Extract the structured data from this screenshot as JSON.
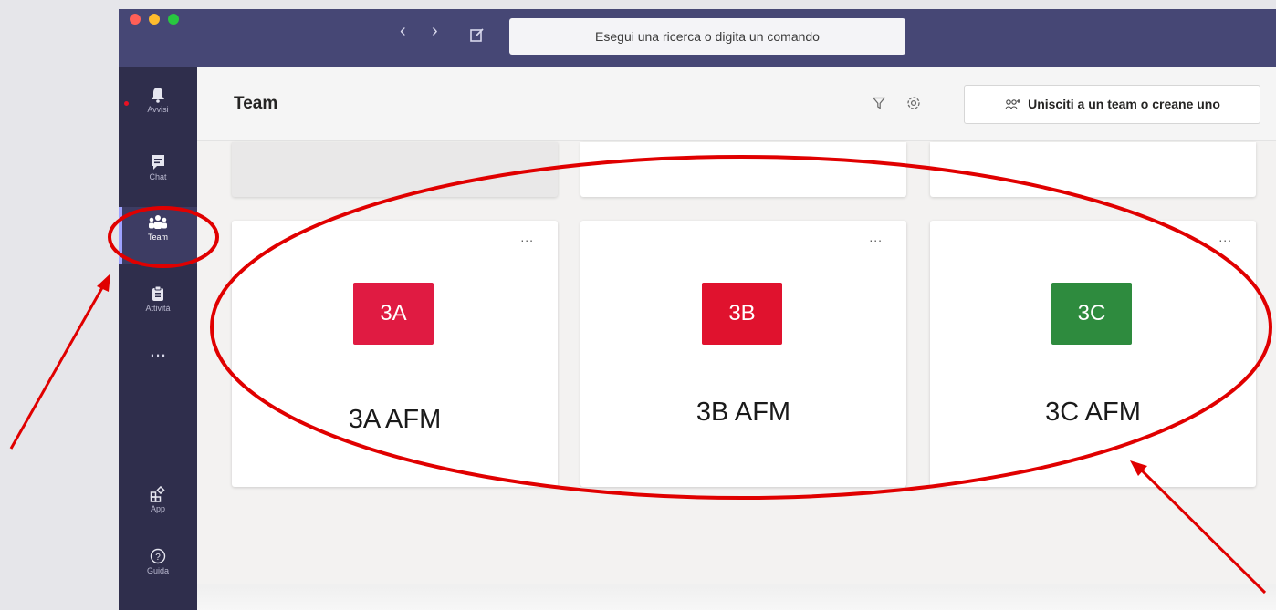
{
  "titlebar": {
    "search_placeholder": "Esegui una ricerca o digita un comando",
    "back_icon": "chevron-left-icon",
    "forward_icon": "chevron-right-icon",
    "compose_icon": "compose-icon"
  },
  "rail": {
    "items": [
      {
        "label": "Avvisi",
        "icon": "bell-icon"
      },
      {
        "label": "Chat",
        "icon": "chat-icon"
      },
      {
        "label": "Team",
        "icon": "team-icon"
      },
      {
        "label": "Attività",
        "icon": "assignments-icon"
      },
      {
        "label": "...",
        "icon": "more-icon"
      },
      {
        "label": "App",
        "icon": "apps-icon"
      },
      {
        "label": "Guida",
        "icon": "help-icon"
      }
    ]
  },
  "header": {
    "title": "Team",
    "join_label": "Unisciti a un team o creane uno"
  },
  "teams": [
    {
      "abbr": "3A",
      "name": "3A AFM",
      "color": "#e01b42"
    },
    {
      "abbr": "3B",
      "name": "3B AFM",
      "color": "#e0122e"
    },
    {
      "abbr": "3C",
      "name": "3C AFM",
      "color": "#2e8b3e"
    }
  ],
  "card_menu_label": "...",
  "colors": {
    "titlebar": "#464775",
    "rail": "#2f2e4c",
    "annotation": "#e00000"
  }
}
